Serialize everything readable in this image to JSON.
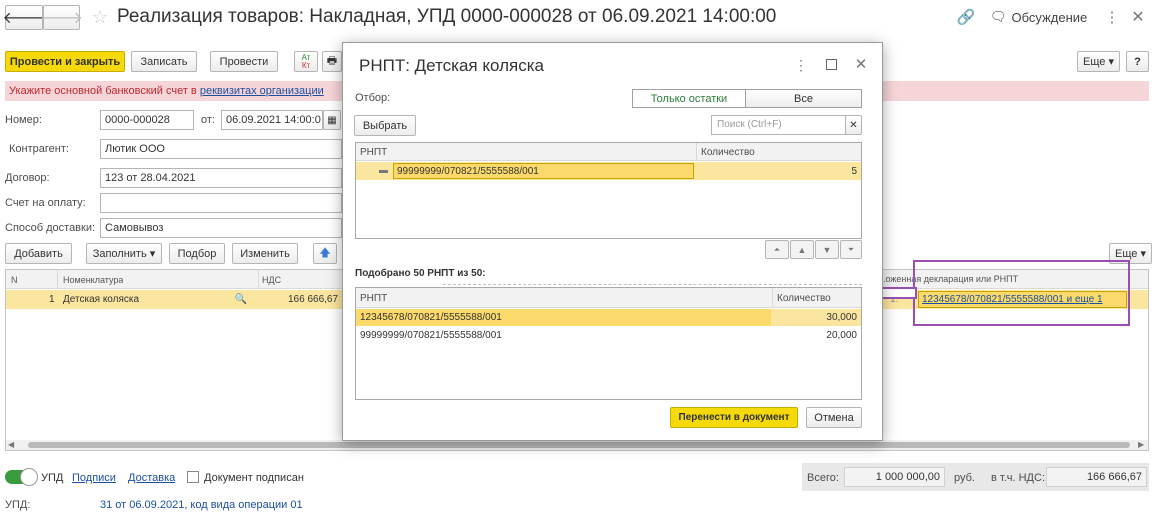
{
  "header": {
    "title": "Реализация товаров: Накладная, УПД 0000-000028 от 06.09.2021 14:00:00",
    "discussion": "Обсуждение"
  },
  "toolbar": {
    "post_close": "Провести и закрыть",
    "save": "Записать",
    "post": "Провести",
    "dtkt_top": "Ат",
    "dtkt_bottom": "Кт",
    "more": "Еще",
    "help": "?"
  },
  "warning": {
    "text": "Укажите основной банковский счет в ",
    "link": "реквизитах организации"
  },
  "form": {
    "number_label": "Номер:",
    "number_value": "0000-000028",
    "date_label": "от:",
    "date_value": "06.09.2021 14:00:0",
    "contractor_label": "Контрагент:",
    "contractor_value": "Лютик ООО",
    "contract_label": "Договор:",
    "contract_value": "123 от 28.04.2021",
    "invoice_label": "Счет на оплату:",
    "invoice_value": "",
    "delivery_label": "Способ доставки:",
    "delivery_value": "Самовывоз"
  },
  "table_toolbar": {
    "add": "Добавить",
    "fill": "Заполнить",
    "pick": "Подбор",
    "change": "Изменить",
    "more": "Еще"
  },
  "goods_table": {
    "columns": {
      "n": "N",
      "nomenclature": "Номенклатура",
      "vat": "НДС",
      "declaration": "...оженная декларация или РНПТ"
    },
    "row": {
      "n": "1",
      "nomenclature": "Детская коляска",
      "vat": "166 666,67",
      "declaration_prefix": "1:",
      "declaration": "12345678/070821/5555588/001 и еще 1"
    }
  },
  "footer": {
    "upd": "УПД",
    "signatures": "Подписи",
    "delivery": "Доставка",
    "signed": "Документ подписан",
    "total_label": "Всего:",
    "total_value": "1 000 000,00",
    "currency": "руб.",
    "vat_label": "в т.ч. НДС:",
    "vat_value": "166 666,67",
    "upd_label": "УПД:",
    "upd_value": "31 от 06.09.2021, код вида операции 01"
  },
  "dialog": {
    "title": "РНПТ: Детская коляска",
    "filter_label": "Отбор:",
    "filter_only_rest": "Только остатки",
    "filter_all": "Все",
    "select_btn": "Выбрать",
    "search_placeholder": "Поиск (Ctrl+F)",
    "top_table": {
      "col_rnpt": "РНПТ",
      "col_qty": "Количество",
      "rows": [
        {
          "rnpt": "99999999/070821/5555588/001",
          "qty": "5"
        }
      ]
    },
    "picked_summary": "Подобрано 50 РНПТ из 50:",
    "bottom_table": {
      "col_rnpt": "РНПТ",
      "col_qty": "Количество",
      "rows": [
        {
          "rnpt": "12345678/070821/5555588/001",
          "qty": "30,000"
        },
        {
          "rnpt": "99999999/070821/5555588/001",
          "qty": "20,000"
        }
      ]
    },
    "transfer_btn": "Перенести в документ",
    "cancel_btn": "Отмена"
  },
  "colors": {
    "accent": "#f5d90a",
    "warning_bg": "#f6d5d8",
    "highlight": "#fbe6a0",
    "annotation": "#9b4fb4"
  }
}
